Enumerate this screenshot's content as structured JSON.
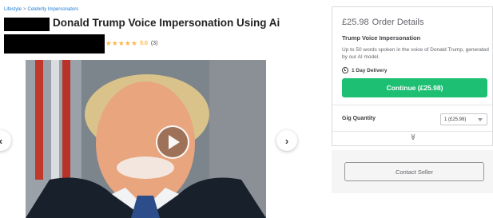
{
  "breadcrumb": {
    "items": [
      "Lifestyle",
      "Celebrity Impersonators"
    ],
    "separator": ">"
  },
  "gig": {
    "title": "Donald Trump Voice Impersonation Using Ai",
    "rating": {
      "stars": "★★★★★",
      "score": "5.0",
      "count": "(3)"
    }
  },
  "gallery": {
    "prev_icon": "chevron-left-icon",
    "next_icon": "chevron-right-icon",
    "play_icon": "play-icon"
  },
  "order": {
    "price": "£25.98",
    "header": "Order Details",
    "package_title": "Trump Voice Impersonation",
    "package_description": "Up to 50 words spoken in the voice of Donald Trump, generated by our AI model.",
    "delivery": "1 Day Delivery",
    "continue_label": "Continue (£25.98)",
    "quantity_label": "Gig Quantity",
    "quantity_value": "1 (£25.98)",
    "expand_icon": "double-chevron-down-icon"
  },
  "contact": {
    "label": "Contact Seller"
  },
  "colors": {
    "accent": "#1dbf73",
    "star": "#ffb33e",
    "link": "#1d7bd6"
  }
}
